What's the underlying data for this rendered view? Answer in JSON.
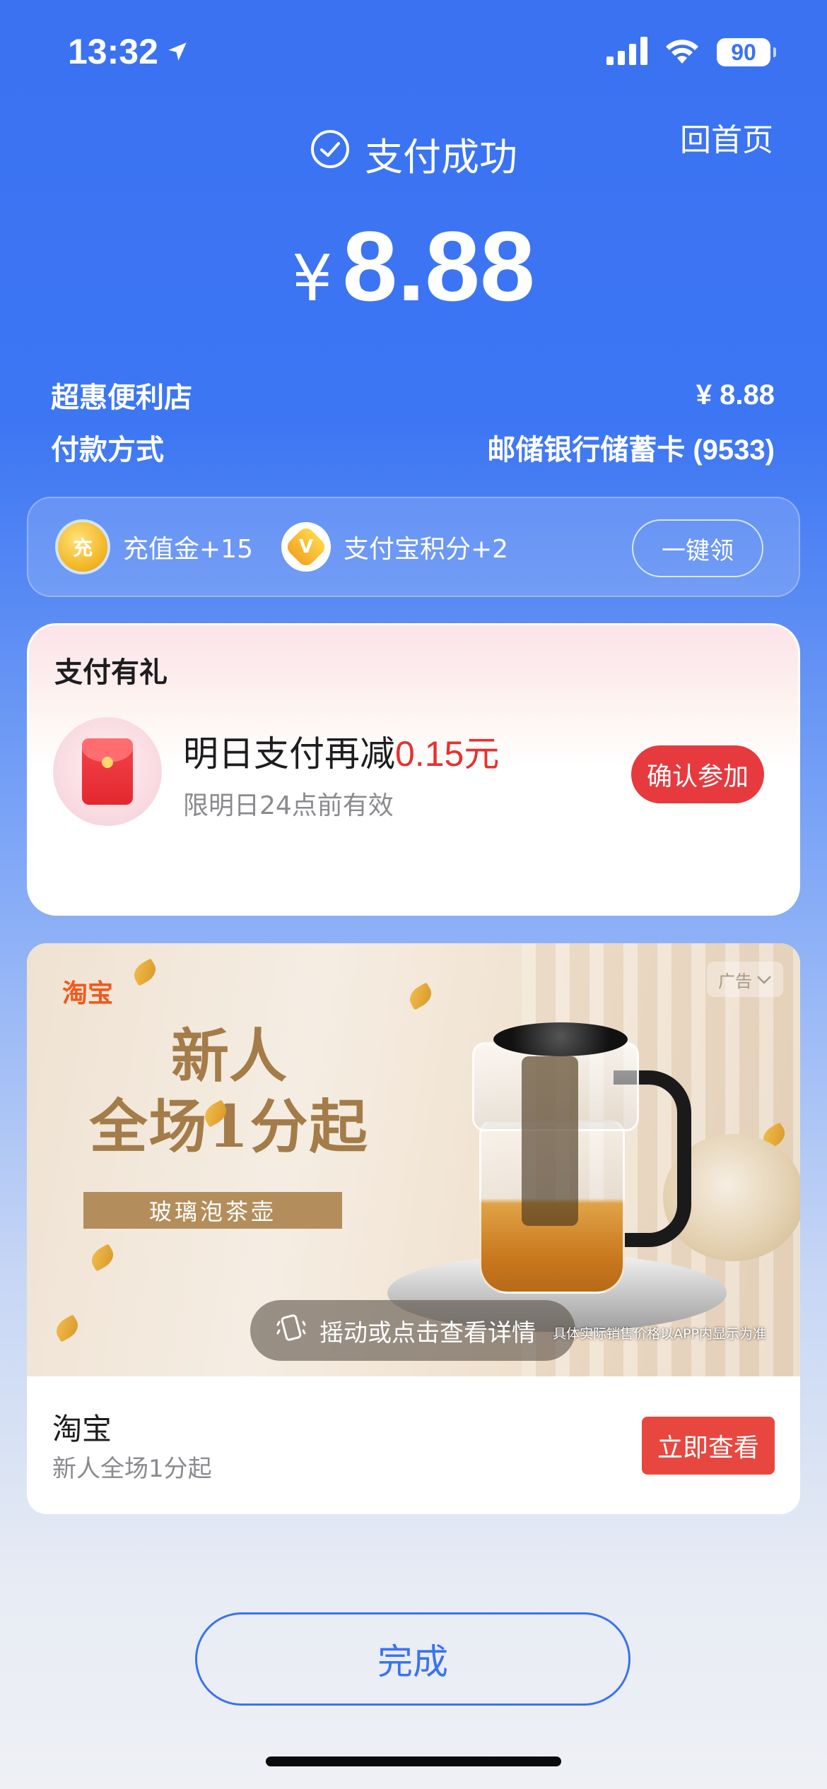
{
  "status_bar": {
    "time": "13:32",
    "battery": "90",
    "icons": [
      "location-arrow-icon",
      "signal-icon",
      "wifi-icon",
      "battery-icon"
    ]
  },
  "header": {
    "home_link": "回首页",
    "status_text": "支付成功",
    "currency": "¥",
    "amount": "8.88"
  },
  "payment_info": {
    "merchant_label": "超惠便利店",
    "merchant_value": "¥ 8.88",
    "method_label": "付款方式",
    "method_value": "邮储银行储蓄卡 (9533)"
  },
  "rewards": {
    "items": [
      {
        "icon": "topup-coin-icon",
        "coin_mark": "充",
        "label": "充值金+15"
      },
      {
        "icon": "alipay-points-icon",
        "coin_mark": "V",
        "label": "支付宝积分+2"
      }
    ],
    "claim_label": "一键领"
  },
  "gift": {
    "title": "支付有礼",
    "offer_prefix": "明日支付再减",
    "offer_amount": "0.15元",
    "validity": "限明日24点前有效",
    "button_label": "确认参加"
  },
  "ad": {
    "brand_logo": "淘宝",
    "badge": "广告",
    "headline_line1": "新人",
    "headline_line2": "全场1分起",
    "product_tag": "玻璃泡茶壶",
    "shake_hint": "摇动或点击查看详情",
    "disclaimer": "具体实际销售价格以APP内显示为准",
    "title": "淘宝",
    "subtitle": "新人全场1分起",
    "button_label": "立即查看"
  },
  "footer": {
    "done_label": "完成"
  },
  "colors": {
    "primary_blue": "#3a72f2",
    "accent_red": "#e8312f",
    "white": "#ffffff"
  }
}
